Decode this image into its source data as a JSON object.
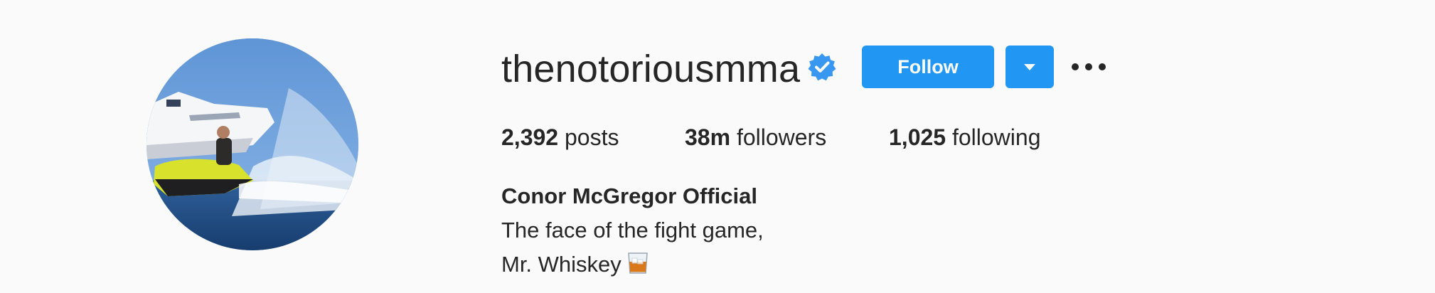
{
  "profile": {
    "username": "thenotoriousmma",
    "verified": true,
    "verified_icon": "verified-badge-icon",
    "full_name": "Conor McGregor Official",
    "bio_lines": [
      "The face of the fight game,",
      "Mr. Whiskey"
    ],
    "bio_emoji": "tumbler-glass-icon"
  },
  "actions": {
    "follow_label": "Follow",
    "dropdown_icon": "chevron-down-icon",
    "more_icon": "more-options-icon"
  },
  "stats": {
    "posts": {
      "count": "2,392",
      "label": "posts"
    },
    "followers": {
      "count": "38m",
      "label": "followers"
    },
    "following": {
      "count": "1,025",
      "label": "following"
    }
  },
  "colors": {
    "accent": "#2196f3",
    "verified_badge": "#3897f0",
    "text": "#262626",
    "background": "#fafafa"
  }
}
